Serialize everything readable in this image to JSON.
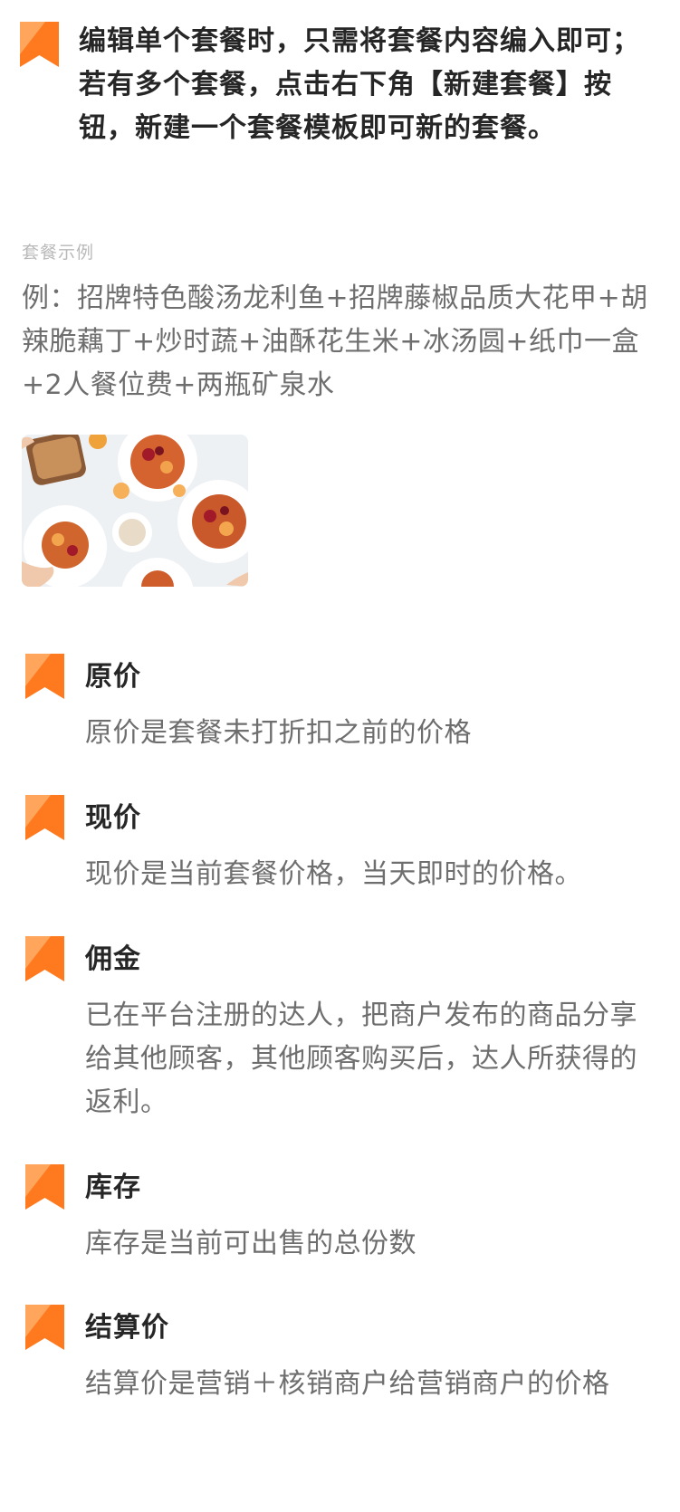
{
  "colors": {
    "accent": "#ff7a1f",
    "accent_light": "#ffa65c",
    "title_text": "#262626",
    "body_text": "#6e6e6e",
    "label_text": "#b9b9b9"
  },
  "intro": {
    "icon": "bookmark-icon",
    "text": "编辑单个套餐时，只需将套餐内容编入即可；若有多个套餐，点击右下角【新建套餐】按钮，新建一个套餐模板即可新的套餐。"
  },
  "example": {
    "label": "套餐示例",
    "text": "例：招牌特色酸汤龙利鱼+招牌藤椒品质大花甲+胡辣脆藕丁+炒时蔬+油酥花生米+冰汤圆+纸巾一盒+2人餐位费+两瓶矿泉水",
    "image_icon": "food-photo"
  },
  "terms": [
    {
      "icon": "bookmark-icon",
      "title": "原价",
      "desc": "原价是套餐未打折扣之前的价格"
    },
    {
      "icon": "bookmark-icon",
      "title": "现价",
      "desc": "现价是当前套餐价格，当天即时的价格。"
    },
    {
      "icon": "bookmark-icon",
      "title": "佣金",
      "desc": "已在平台注册的达人，把商户发布的商品分享给其他顾客，其他顾客购买后，达人所获得的返利。"
    },
    {
      "icon": "bookmark-icon",
      "title": "库存",
      "desc": "库存是当前可出售的总份数"
    },
    {
      "icon": "bookmark-icon",
      "title": "结算价",
      "desc": "结算价是营销＋核销商户给营销商户的价格"
    }
  ]
}
